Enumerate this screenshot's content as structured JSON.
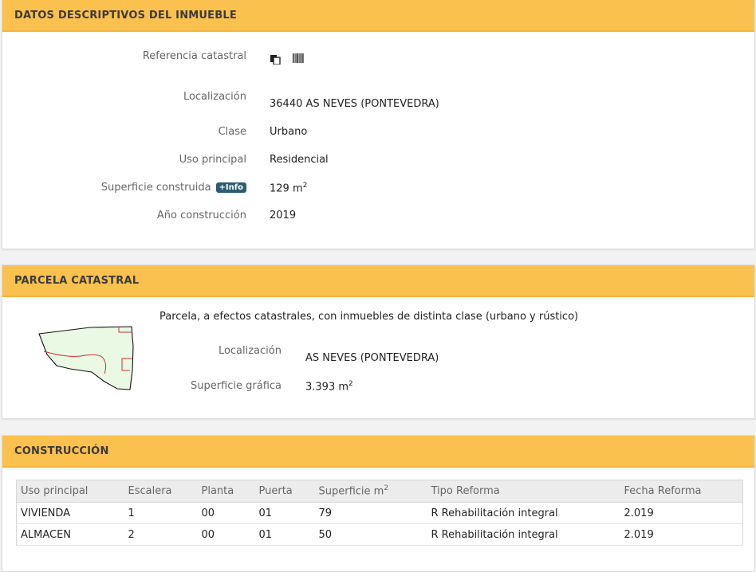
{
  "datos": {
    "title": "DATOS DESCRIPTIVOS DEL INMUEBLE",
    "ref_label": "Referencia catastral",
    "ref_icons": [
      "copy-icon",
      "barcode-icon"
    ],
    "loc_label": "Localización",
    "loc_value": "36440 AS NEVES (PONTEVEDRA)",
    "clase_label": "Clase",
    "clase_value": "Urbano",
    "uso_label": "Uso principal",
    "uso_value": "Residencial",
    "sup_label": "Superficie construida",
    "sup_badge": "+Info",
    "sup_value": "129 m",
    "sup_unit_exp": "2",
    "anio_label": "Año construcción",
    "anio_value": "2019"
  },
  "parcela": {
    "title": "PARCELA CATASTRAL",
    "description": "Parcela, a efectos catastrales, con inmuebles de distinta clase (urbano y rústico)",
    "loc_label": "Localización",
    "loc_value": "AS NEVES (PONTEVEDRA)",
    "sup_label": "Superficie gráfica",
    "sup_value": "3.393 m",
    "sup_unit_exp": "2"
  },
  "construccion": {
    "title": "CONSTRUCCIÓN",
    "headers": [
      "Uso principal",
      "Escalera",
      "Planta",
      "Puerta",
      "Superficie m",
      "Tipo Reforma",
      "Fecha Reforma"
    ],
    "sup_header_exp": "2",
    "rows": [
      [
        "VIVIENDA",
        "1",
        "00",
        "01",
        "79",
        "R Rehabilitación integral",
        "2.019"
      ],
      [
        "ALMACEN",
        "2",
        "00",
        "01",
        "50",
        "R Rehabilitación integral",
        "2.019"
      ]
    ]
  },
  "colors": {
    "header": "#fbc14e",
    "badge": "#2b5d6f",
    "parcel_fill": "#eaf9e4",
    "parcel_line": "#d23030"
  }
}
